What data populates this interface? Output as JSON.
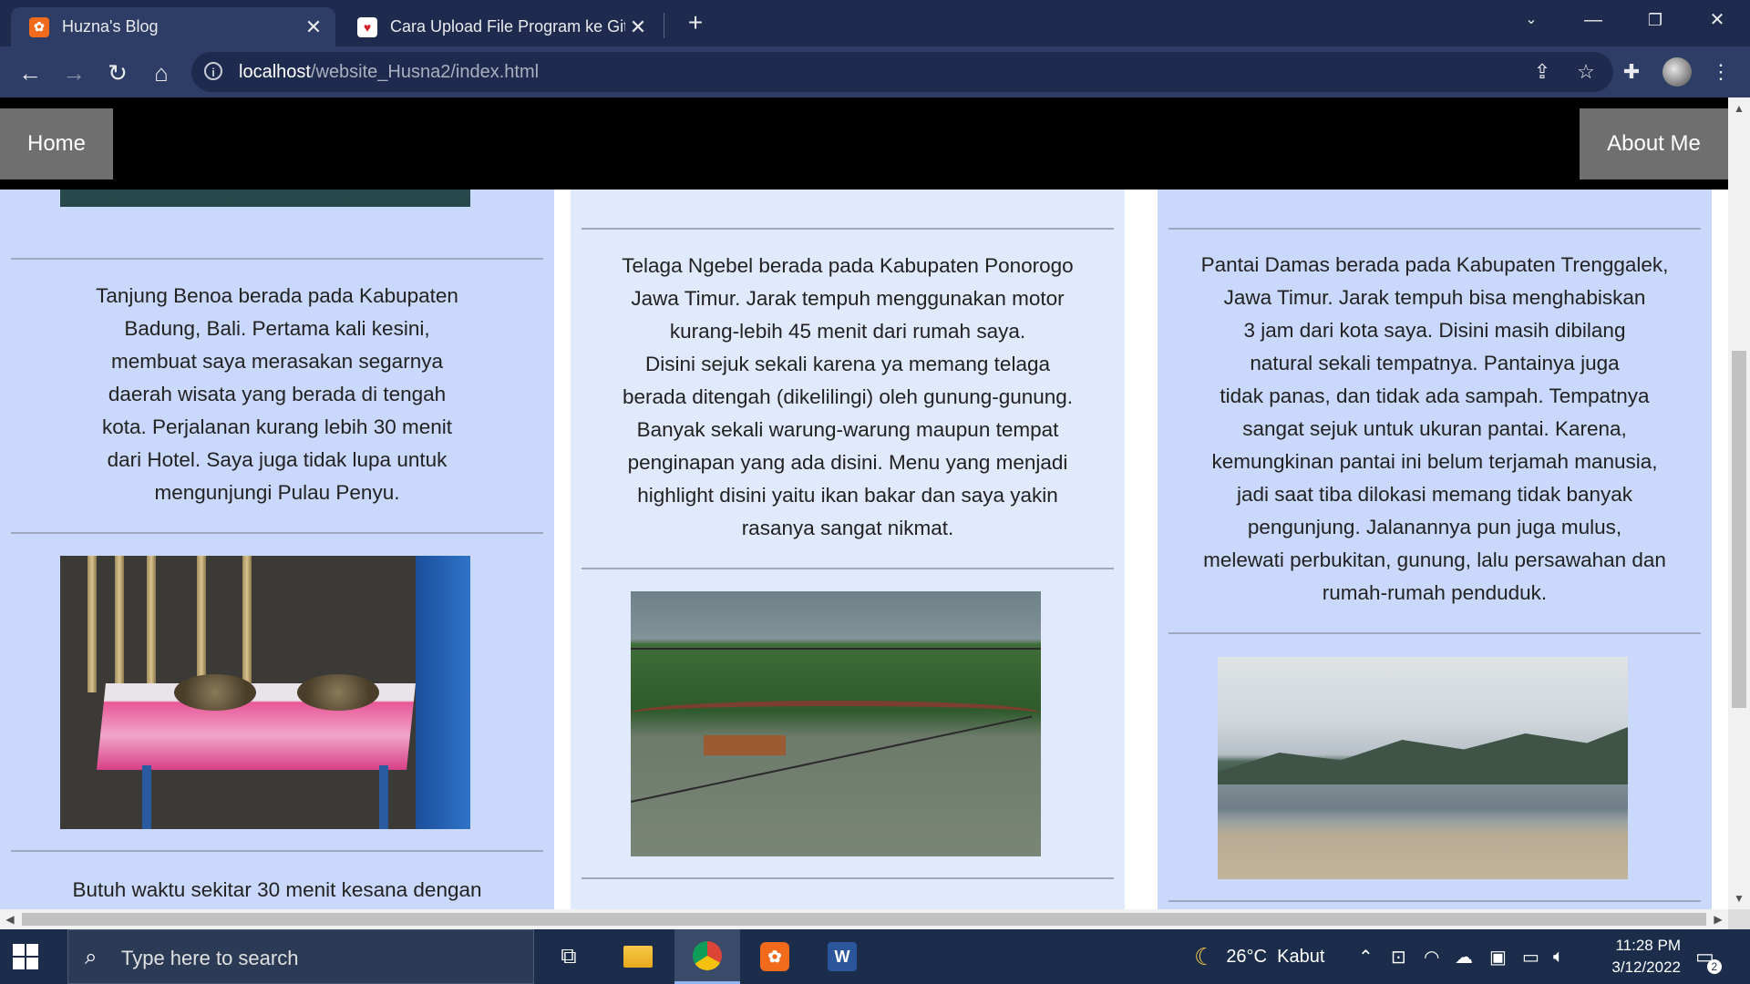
{
  "browser": {
    "tabs": [
      {
        "title": "Huzna's Blog",
        "icon": "xampp-icon",
        "active": true
      },
      {
        "title": "Cara Upload File Program ke GitHub",
        "icon": "heart-favicon-icon",
        "active": false
      }
    ],
    "url": {
      "host": "localhost",
      "path": "/website_Husna2/index.html"
    }
  },
  "page": {
    "nav": {
      "home": "Home",
      "about": "About Me"
    },
    "columns": [
      {
        "paragraph1": [
          "Tanjung Benoa berada pada Kabupaten",
          "Badung, Bali. Pertama kali kesini,",
          "membuat saya merasakan segarnya",
          "daerah wisata yang berada di tengah",
          "kota. Perjalanan kurang lebih 30 menit",
          "dari Hotel. Saya juga tidak lupa untuk",
          "mengunjungi Pulau Penyu."
        ],
        "paragraph2": [
          "Butuh waktu sekitar 30 menit kesana dengan"
        ]
      },
      {
        "paragraph1": [
          "Telaga Ngebel berada pada Kabupaten Ponorogo",
          "Jawa Timur. Jarak tempuh menggunakan motor",
          "kurang-lebih 45 menit dari rumah saya.",
          "Disini sejuk sekali karena ya memang telaga",
          "berada ditengah (dikelilingi) oleh gunung-gunung.",
          "Banyak sekali warung-warung maupun tempat",
          "penginapan yang ada disini. Menu yang menjadi",
          "highlight disini yaitu ikan bakar dan saya yakin",
          "rasanya sangat nikmat."
        ]
      },
      {
        "paragraph1": [
          "Pantai Damas berada pada Kabupaten Trenggalek,",
          "Jawa Timur. Jarak tempuh bisa menghabiskan",
          "3 jam dari kota saya. Disini masih dibilang",
          "natural sekali tempatnya. Pantainya juga",
          "tidak panas, dan tidak ada sampah. Tempatnya",
          "sangat sejuk untuk ukuran pantai. Karena,",
          "kemungkinan pantai ini belum terjamah manusia,",
          "jadi saat tiba dilokasi memang tidak banyak",
          "pengunjung. Jalanannya pun juga mulus,",
          "melewati perbukitan, gunung, lalu persawahan dan",
          "rumah-rumah penduduk."
        ]
      }
    ]
  },
  "taskbar": {
    "search_placeholder": "Type here to search",
    "weather": "26°C  Kabut",
    "time": "11:28 PM",
    "date": "3/12/2022",
    "notification_count": "2"
  },
  "colors": {
    "tabbar": "#1f2b4e",
    "toolbar": "#2e3d66",
    "column_blue": "#c9d8fb",
    "column_light": "#e1e9fc",
    "nav_black": "#000000",
    "nav_button": "#6f6f6f"
  }
}
